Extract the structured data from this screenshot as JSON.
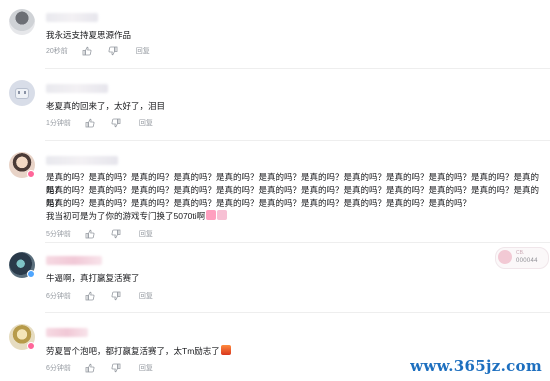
{
  "comments": [
    {
      "text": "我永远支持夏思源作品",
      "time": "20秒前",
      "reply": "回复"
    },
    {
      "text": "老夏真的回来了，太好了，泪目",
      "time": "1分钟前",
      "reply": "回复"
    },
    {
      "lines": [
        "是真的吗？是真的吗？是真的吗？是真的吗？是真的吗？是真的吗？是真的吗？是真的吗？是真的吗？是真的吗？是真的吗？是真的吗？",
        "是真的吗？是真的吗？是真的吗？是真的吗？是真的吗？是真的吗？是真的吗？是真的吗？是真的吗？是真的吗？是真的吗？是真的吗？",
        "是真的吗？是真的吗？是真的吗？是真的吗？是真的吗？是真的吗？是真的吗？是真的吗？是真的吗？是真的吗？",
        "我当初可是为了你的游戏专门换了5070ti啊"
      ],
      "time": "5分钟前",
      "reply": "回复"
    },
    {
      "text": "牛逼啊，真打赢复活赛了",
      "time": "6分钟前",
      "reply": "回复",
      "fan_card": {
        "label": "CB.",
        "number": "000044"
      }
    },
    {
      "text": "劳夏冒个泡吧，都打赢复活赛了，太Tm励志了",
      "time": "6分钟前",
      "reply": "回复"
    }
  ],
  "watermark": "www.365jz.com",
  "icons": [
    "like-icon",
    "dislike-icon"
  ],
  "colors": {
    "meta": "#9499a0",
    "pink": "#ff6699",
    "watermark": "#1d6fbf"
  }
}
